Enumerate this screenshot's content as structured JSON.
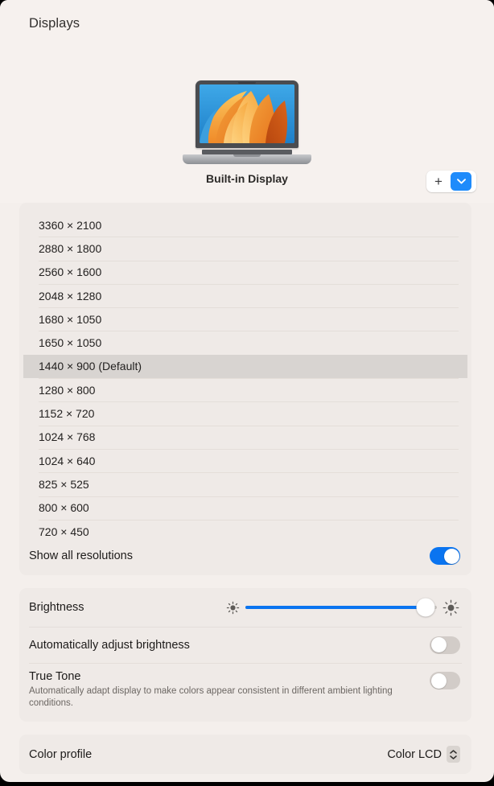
{
  "window": {
    "title": "Displays"
  },
  "header": {
    "display_name": "Built-in Display",
    "add_button": {
      "plus_label": "+",
      "plus_icon": "plus-icon",
      "chevron_icon": "chevron-down-icon"
    },
    "laptop_icon": "macbook-icon"
  },
  "resolutions": {
    "items": [
      {
        "label": "3360 × 2100",
        "selected": false
      },
      {
        "label": "2880 × 1800",
        "selected": false
      },
      {
        "label": "2560 × 1600",
        "selected": false
      },
      {
        "label": "2048 × 1280",
        "selected": false
      },
      {
        "label": "1680 × 1050",
        "selected": false
      },
      {
        "label": "1650 × 1050",
        "selected": false
      },
      {
        "label": "1440 × 900 (Default)",
        "selected": true
      },
      {
        "label": "1280 × 800",
        "selected": false
      },
      {
        "label": "1152 × 720",
        "selected": false
      },
      {
        "label": "1024 × 768",
        "selected": false
      },
      {
        "label": "1024 × 640",
        "selected": false
      },
      {
        "label": "825 × 525",
        "selected": false
      },
      {
        "label": "800 × 600",
        "selected": false
      },
      {
        "label": "720 × 450",
        "selected": false
      }
    ],
    "show_all": {
      "label": "Show all resolutions",
      "state": "on"
    }
  },
  "brightness": {
    "label": "Brightness",
    "value_percent": 94,
    "icon_low": "sun-small-icon",
    "icon_high": "sun-large-icon",
    "auto_adjust": {
      "label": "Automatically adjust brightness",
      "state": "off"
    },
    "true_tone": {
      "label": "True Tone",
      "description": "Automatically adapt display to make colors appear consistent in different ambient lighting conditions.",
      "state": "off"
    }
  },
  "color_profile": {
    "label": "Color profile",
    "value": "Color LCD",
    "stepper_icon": "chevron-up-down-icon"
  },
  "colors": {
    "accent": "#0A74F0",
    "window_bg": "#F4EFEC",
    "header_bg": "#F6F1EE",
    "card_bg": "#EFEAE7",
    "selected_row": "#D8D4D1"
  }
}
